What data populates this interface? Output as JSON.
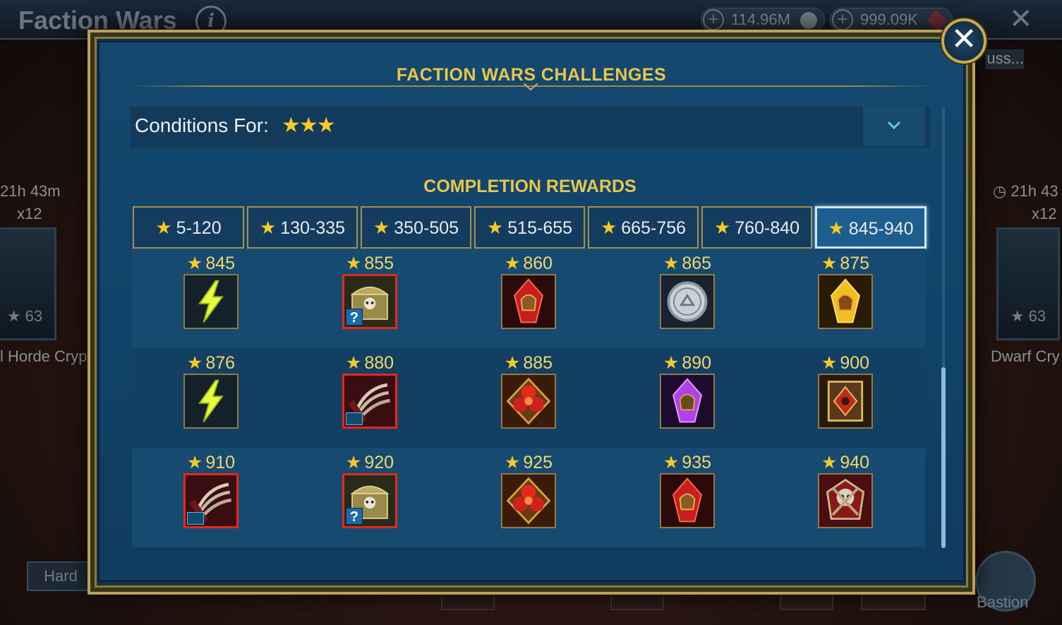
{
  "background": {
    "title": "Faction Wars",
    "resources": [
      {
        "value": "114.96M",
        "icon": "silver-coin-icon"
      },
      {
        "value": "999.09K",
        "icon": "ruby-gem-icon"
      }
    ],
    "partial_label": "uss...",
    "left_crypt": {
      "timer": "21h 43m",
      "keys": "x12",
      "stars": "63",
      "name": "l Horde Crypt"
    },
    "right_crypt": {
      "timer": "21h 43",
      "keys": "x12",
      "stars": "63",
      "name": "Dwarf Cry"
    },
    "difficulty": "Hard",
    "bastion_label": "Bastion"
  },
  "dialog": {
    "title": "FACTION WARS CHALLENGES",
    "conditions_label": "Conditions For:",
    "conditions_stars": "★★★",
    "rewards_title": "COMPLETION REWARDS",
    "tabs": [
      {
        "label": "5-120",
        "active": false
      },
      {
        "label": "130-335",
        "active": false
      },
      {
        "label": "350-505",
        "active": false
      },
      {
        "label": "515-655",
        "active": false
      },
      {
        "label": "665-756",
        "active": false
      },
      {
        "label": "760-840",
        "active": false
      },
      {
        "label": "845-940",
        "active": true
      }
    ],
    "rewards": [
      [
        {
          "stars": "845",
          "item": "energy-bolt-icon"
        },
        {
          "stars": "855",
          "item": "mystery-chest-icon",
          "badge": "?"
        },
        {
          "stars": "860",
          "item": "red-helmet-shard-icon"
        },
        {
          "stars": "865",
          "item": "silver-coin-icon"
        },
        {
          "stars": "875",
          "item": "gold-helmet-shard-icon"
        }
      ],
      [
        {
          "stars": "876",
          "item": "energy-bolt-icon"
        },
        {
          "stars": "880",
          "item": "claw-artifact-icon",
          "badge": "artifact"
        },
        {
          "stars": "885",
          "item": "red-flower-potion-icon"
        },
        {
          "stars": "890",
          "item": "purple-helmet-shard-icon"
        },
        {
          "stars": "900",
          "item": "gold-tome-icon"
        }
      ],
      [
        {
          "stars": "910",
          "item": "claw-artifact-icon",
          "badge": "artifact"
        },
        {
          "stars": "920",
          "item": "mystery-chest-icon",
          "badge": "?"
        },
        {
          "stars": "925",
          "item": "red-flower-potion-icon"
        },
        {
          "stars": "935",
          "item": "red-helmet-shard-icon"
        },
        {
          "stars": "940",
          "item": "skull-crest-icon"
        }
      ]
    ],
    "colors": {
      "title": "#e6c64d",
      "star": "#f6c82a",
      "accent_frame": "#b9a158",
      "highlight_border": "#e12a1a"
    }
  }
}
